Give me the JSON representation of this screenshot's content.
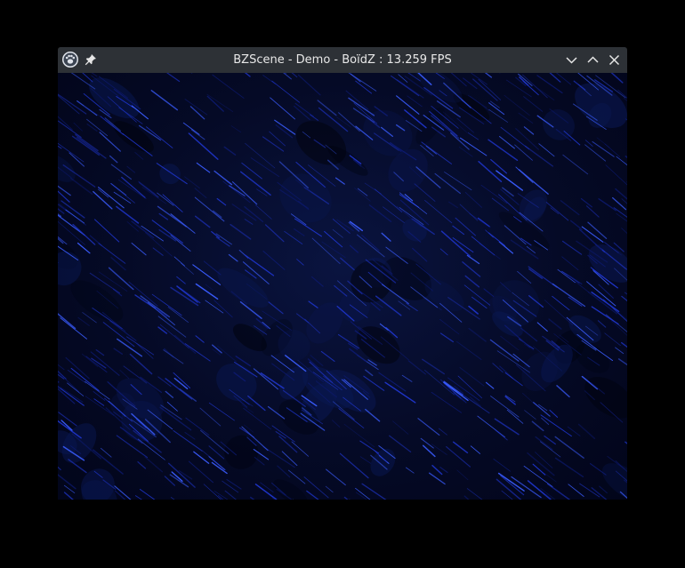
{
  "window": {
    "title": "BZScene - Demo - BoïdZ : 13.259 FPS",
    "app_icon": "app-logo-icon",
    "pin_icon": "pin-icon",
    "controls": {
      "minimize_icon": "chevron-down-icon",
      "maximize_icon": "chevron-up-icon",
      "close_icon": "close-icon"
    }
  },
  "scene": {
    "name": "boidz-rain",
    "colors": {
      "background": "#050a26",
      "streak_bright": "#3a5cff",
      "streak_mid": "#1e34c8",
      "streak_dim": "#0d1a70",
      "titlebar": "#2d3136"
    }
  }
}
